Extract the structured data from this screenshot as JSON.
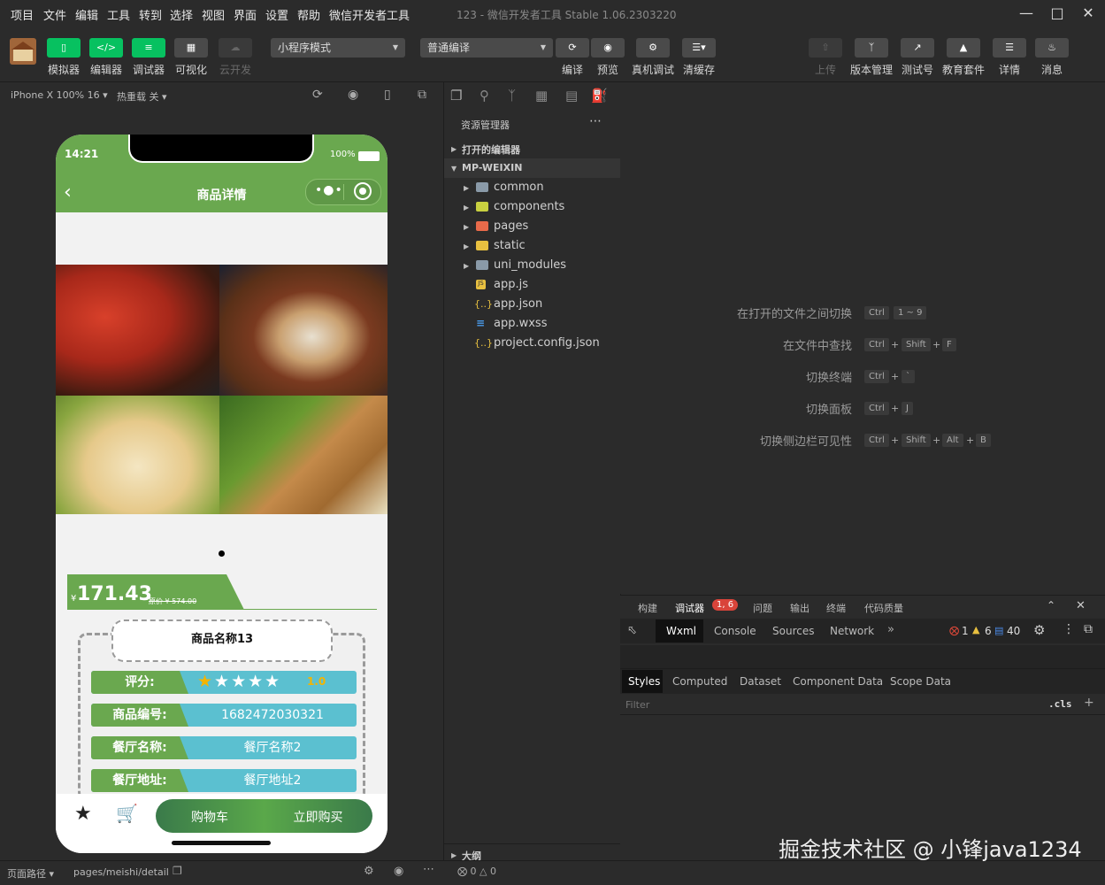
{
  "menu": [
    "项目",
    "文件",
    "编辑",
    "工具",
    "转到",
    "选择",
    "视图",
    "界面",
    "设置",
    "帮助",
    "微信开发者工具"
  ],
  "window_title": "123 - 微信开发者工具 Stable 1.06.2303220",
  "toolbar": {
    "simulator": "模拟器",
    "editor": "编辑器",
    "debugger": "调试器",
    "visual": "可视化",
    "cloud": "云开发",
    "mode_select": "小程序模式",
    "compile_select": "普通编译",
    "compile": "编译",
    "preview": "预览",
    "remote_debug": "真机调试",
    "clear_cache": "清缓存",
    "upload": "上传",
    "version": "版本管理",
    "test": "测试号",
    "edu": "教育套件",
    "details": "详情",
    "messages": "消息"
  },
  "simbar": {
    "device": "iPhone X 100% 16",
    "hot_reload": "热重载 关"
  },
  "phone": {
    "time": "14:21",
    "battery": "100%",
    "nav_title": "商品详情",
    "price_symbol": "¥",
    "price": "171.43",
    "orig_price": "原价 ¥ 574.00",
    "product_name": "商品名称13",
    "rows": [
      {
        "label": "评分:",
        "value": "1.0"
      },
      {
        "label": "商品编号:",
        "value": "1682472030321"
      },
      {
        "label": "餐厅名称:",
        "value": "餐厅名称2"
      },
      {
        "label": "餐厅地址:",
        "value": "餐厅地址2"
      }
    ],
    "rating": 1.0,
    "cart_btn": "购物车",
    "buy_btn": "立即购买"
  },
  "explorer": {
    "title": "资源管理器",
    "open_editors": "打开的编辑器",
    "root": "MP-WEIXIN",
    "folders": [
      "common",
      "components",
      "pages",
      "static",
      "uni_modules"
    ],
    "files": [
      "app.js",
      "app.json",
      "app.wxss",
      "project.config.json"
    ],
    "outline": "大纲"
  },
  "hints": [
    {
      "label": "在打开的文件之间切换",
      "keys": [
        "Ctrl",
        "1 ~ 9"
      ]
    },
    {
      "label": "在文件中查找",
      "keys": [
        "Ctrl",
        "Shift",
        "F"
      ]
    },
    {
      "label": "切换终端",
      "keys": [
        "Ctrl",
        "`"
      ]
    },
    {
      "label": "切换面板",
      "keys": [
        "Ctrl",
        "J"
      ]
    },
    {
      "label": "切换侧边栏可见性",
      "keys": [
        "Ctrl",
        "Shift",
        "Alt",
        "B"
      ]
    }
  ],
  "devtools": {
    "top_tabs": [
      "构建",
      "调试器",
      "问题",
      "输出",
      "终端",
      "代码质量"
    ],
    "debugger_badge": "1, 6",
    "tabs": [
      "Wxml",
      "Console",
      "Sources",
      "Network"
    ],
    "errors": "1",
    "warnings": "6",
    "infos": "40",
    "sub_tabs": [
      "Styles",
      "Computed",
      "Dataset",
      "Component Data",
      "Scope Data"
    ],
    "filter_placeholder": "Filter",
    "cls": ".cls"
  },
  "status": {
    "page_path_label": "页面路径",
    "page_path": "pages/meishi/detail",
    "errors": "0",
    "warnings": "0"
  },
  "watermark": "掘金技术社区 @ 小锋java1234"
}
